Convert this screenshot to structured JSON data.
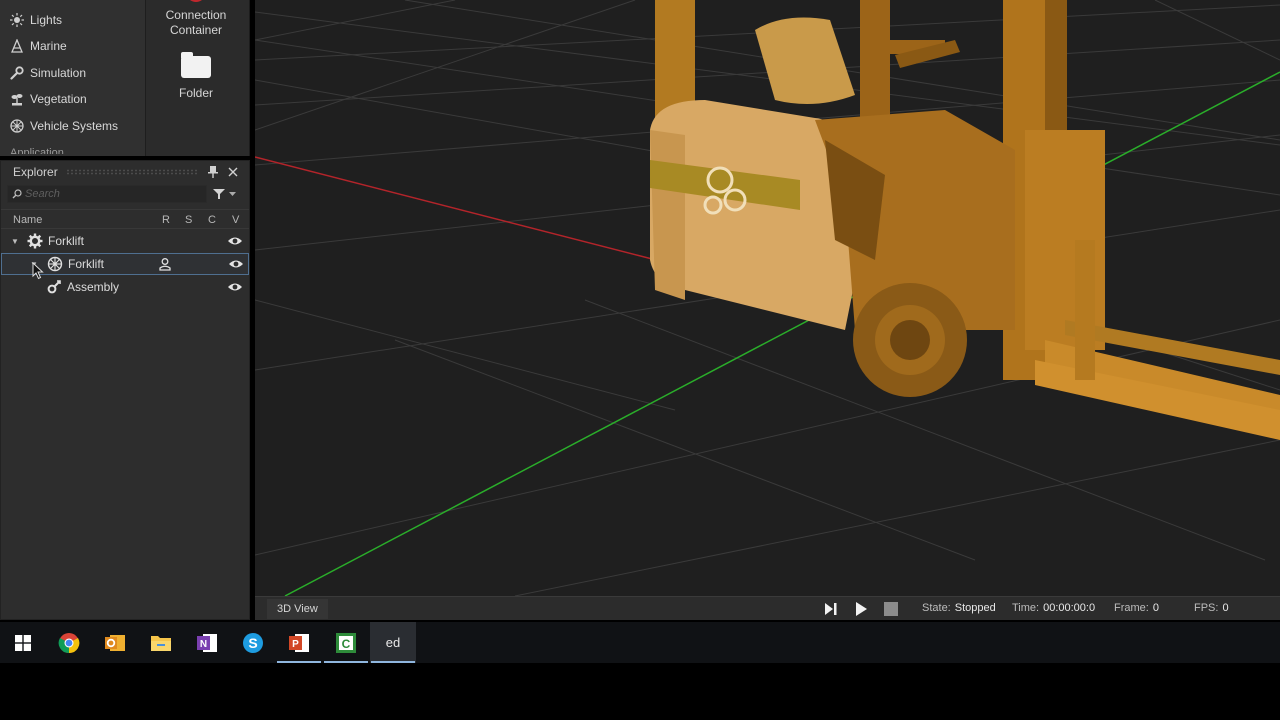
{
  "library": {
    "categories": [
      {
        "label": "Lights",
        "icon": "sun-icon"
      },
      {
        "label": "Marine",
        "icon": "anchor-icon"
      },
      {
        "label": "Simulation",
        "icon": "wrench-icon"
      },
      {
        "label": "Vegetation",
        "icon": "plant-icon"
      },
      {
        "label": "Vehicle Systems",
        "icon": "wheel-icon"
      }
    ],
    "cut_off_category": "Application",
    "items": [
      {
        "label": "Connection Container",
        "icon": "connection-icon"
      },
      {
        "label": "Folder",
        "icon": "folder-icon"
      }
    ]
  },
  "explorer": {
    "title": "Explorer",
    "search_placeholder": "Search",
    "columns": {
      "name": "Name",
      "r": "R",
      "s": "S",
      "c": "C",
      "v": "V"
    },
    "tree": [
      {
        "label": "Forklift",
        "icon": "gear-icon",
        "level": 0,
        "expanded": true
      },
      {
        "label": "Forklift",
        "icon": "vehicle-wheel-icon",
        "level": 1,
        "expanded": true,
        "selected": true,
        "user_owned": true
      },
      {
        "label": "Assembly",
        "icon": "assembly-icon",
        "level": 2
      }
    ]
  },
  "viewport": {
    "tab_label": "3D View",
    "state_label": "State:",
    "state_value": "Stopped",
    "time_label": "Time:",
    "time_value": "00:00:00:0",
    "frame_label": "Frame:",
    "frame_value": "0",
    "fps_label": "FPS:",
    "fps_value": "0"
  },
  "taskbar": {
    "apps": [
      "windows-start-icon",
      "chrome-icon",
      "outlook-icon",
      "file-explorer-icon",
      "onenote-icon",
      "skype-icon",
      "powerpoint-icon",
      "camtasia-icon",
      "editor-icon"
    ],
    "editor_glyph": "ed"
  },
  "colors": {
    "panel": "#2d2d2d",
    "viewport_bg": "#1f1f1f",
    "x_axis": "#c0272d",
    "y_axis": "#2fbf2f",
    "forklift": "#c98a2a",
    "selection_border": "#4f6f90"
  }
}
